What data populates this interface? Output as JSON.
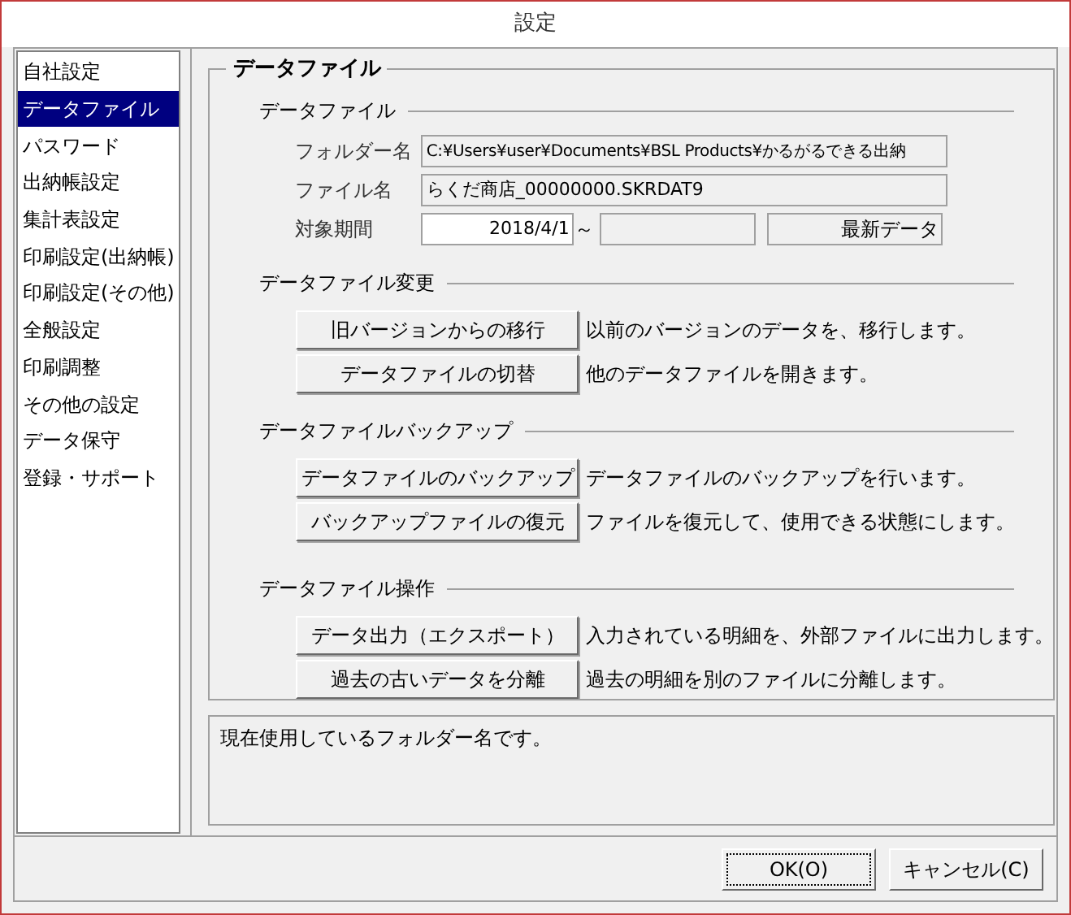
{
  "window": {
    "title": "設定"
  },
  "sidebar": {
    "items": [
      {
        "label": "自社設定",
        "selected": false
      },
      {
        "label": "データファイル",
        "selected": true
      },
      {
        "label": "パスワード",
        "selected": false
      },
      {
        "label": "出納帳設定",
        "selected": false
      },
      {
        "label": "集計表設定",
        "selected": false
      },
      {
        "label": "印刷設定(出納帳)",
        "selected": false
      },
      {
        "label": "印刷設定(その他)",
        "selected": false
      },
      {
        "label": "全般設定",
        "selected": false
      },
      {
        "label": "印刷調整",
        "selected": false
      },
      {
        "label": "その他の設定",
        "selected": false
      },
      {
        "label": "データ保守",
        "selected": false
      },
      {
        "label": "登録・サポート",
        "selected": false
      }
    ]
  },
  "panel": {
    "title": "データファイル",
    "file_section": {
      "title": "データファイル",
      "folder": {
        "label": "フォルダー名",
        "value": "C:¥Users¥user¥Documents¥BSL Products¥かるがるできる出納"
      },
      "file": {
        "label": "ファイル名",
        "value": "らくだ商店_00000000.SKRDAT9"
      },
      "period": {
        "label": "対象期間",
        "from": "2018/4/1",
        "separator": "～",
        "latest": "最新データ"
      }
    },
    "sections": [
      {
        "title": "データファイル変更",
        "actions": [
          {
            "button": "旧バージョンからの移行",
            "description": "以前のバージョンのデータを、移行します。"
          },
          {
            "button": "データファイルの切替",
            "description": "他のデータファイルを開きます。"
          }
        ]
      },
      {
        "title": "データファイルバックアップ",
        "actions": [
          {
            "button": "データファイルのバックアップ",
            "description": "データファイルのバックアップを行います。"
          },
          {
            "button": "バックアップファイルの復元",
            "description": "ファイルを復元して、使用できる状態にします。"
          }
        ]
      },
      {
        "title": "データファイル操作",
        "actions": [
          {
            "button": "データ出力（エクスポート）",
            "description": "入力されている明細を、外部ファイルに出力します。"
          },
          {
            "button": "過去の古いデータを分離",
            "description": "過去の明細を別のファイルに分離します。"
          }
        ]
      }
    ]
  },
  "help_text": "現在使用しているフォルダー名です。",
  "buttons": [
    {
      "label": "OK(O)",
      "focused": true
    },
    {
      "label": "キャンセル(C)",
      "focused": false
    }
  ]
}
